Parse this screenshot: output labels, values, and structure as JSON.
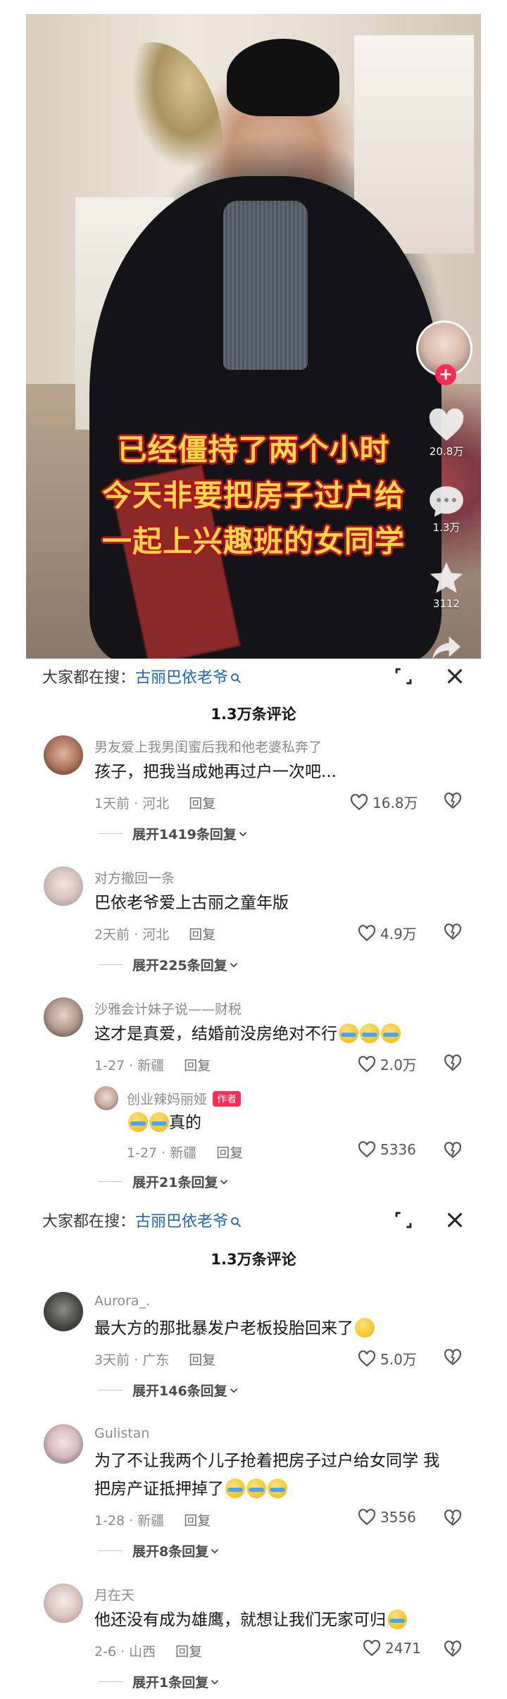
{
  "video": {
    "caption_lines": [
      "已经僵持了两个小时",
      "今天非要把房子过户给",
      "一起上兴趣班的女同学"
    ],
    "likes": "20.8万",
    "comments": "1.3万",
    "favorites": "3112"
  },
  "search_bar": {
    "prefix": "大家都在搜：",
    "keyword": "古丽巴依老爷"
  },
  "comments_title": "1.3万条评论",
  "panel1": {
    "comments": [
      {
        "name": "男友爱上我男闺蜜后我和他老婆私奔了",
        "text": "孩子，把我当成她再过户一次吧...",
        "meta": "1天前 · 河北",
        "reply": "回复",
        "likes": "16.8万",
        "expand": "展开1419条回复"
      },
      {
        "name": "对方撤回一条",
        "text": "巴依老爷爱上古丽之童年版",
        "meta": "2天前 · 河北",
        "reply": "回复",
        "likes": "4.9万",
        "expand": "展开225条回复"
      },
      {
        "name": "沙雅会计妹子说——财税",
        "text": "这才是真爱，结婚前没房绝对不行",
        "meta": "1-27 · 新疆",
        "reply": "回复",
        "likes": "2.0万"
      }
    ],
    "sub_reply": {
      "name": "创业辣妈丽娅",
      "badge": "作者",
      "text": "真的",
      "meta": "1-27 · 新疆",
      "reply": "回复",
      "likes": "5336"
    },
    "expand_more": "展开21条回复"
  },
  "panel2": {
    "comments": [
      {
        "name": "Aurora_.",
        "text": "最大方的那批暴发户老板投胎回来了",
        "meta": "3天前 · 广东",
        "reply": "回复",
        "likes": "5.0万",
        "expand": "展开146条回复"
      },
      {
        "name": "Gulistan",
        "text_line1": "为了不让我两个儿子抢着把房子过户给女同学 我",
        "text_line2": "把房产证抵押掉了",
        "meta": "1-28 · 新疆",
        "reply": "回复",
        "likes": "3556",
        "expand": "展开8条回复"
      },
      {
        "name": "月在天",
        "text": "他还没有成为雄鹰，就想让我们无家可归",
        "meta": "2-6 · 山西",
        "reply": "回复",
        "likes": "2471",
        "expand": "展开1条回复"
      }
    ]
  },
  "icons": {
    "search": "search-icon",
    "expand": "fullscreen-icon",
    "close": "close-icon",
    "like": "heart-icon",
    "dislike": "dislike-icon",
    "chevron": "chevron-down-icon"
  },
  "colors": {
    "accent": "#fe2c55",
    "keyword": "#1f65b5",
    "caption_fill": "#ffd84a",
    "caption_stroke": "#b3121b"
  }
}
